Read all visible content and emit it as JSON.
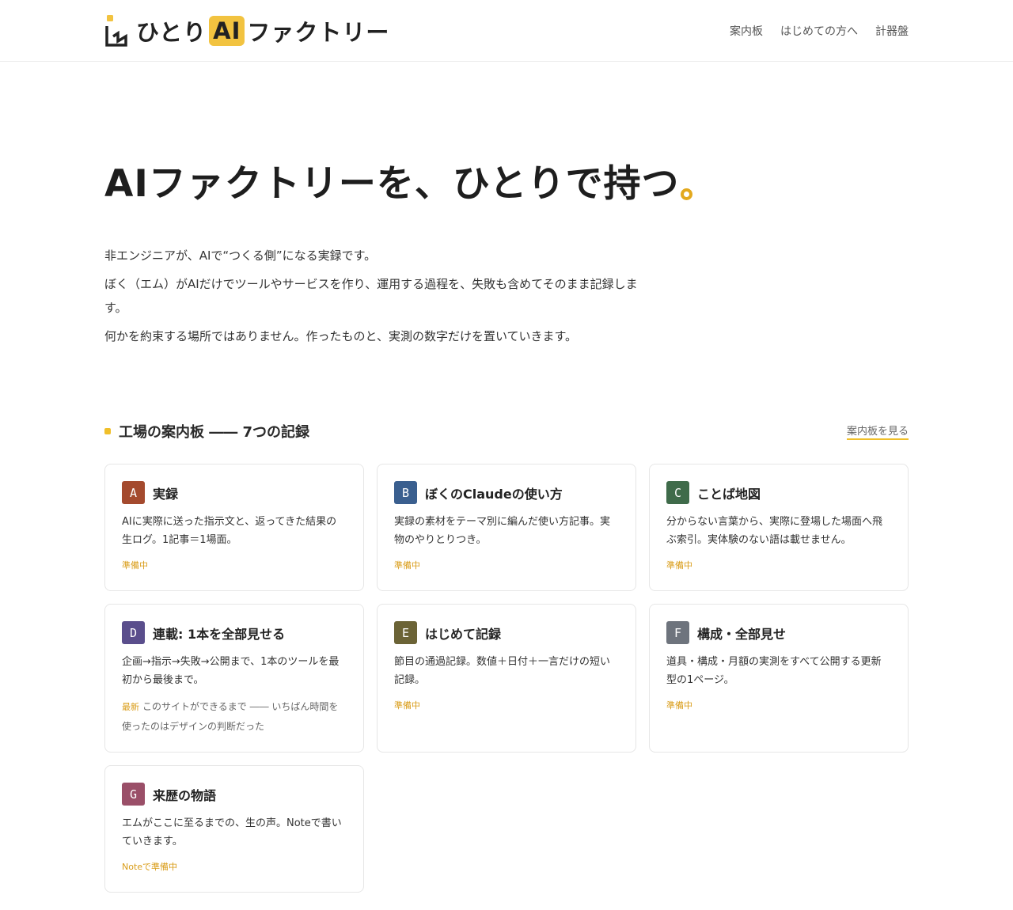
{
  "header": {
    "logo": {
      "word_before": "ひとり",
      "word_ai": "AI",
      "word_after": "ファクトリー"
    },
    "nav": [
      {
        "label": "案内板"
      },
      {
        "label": "はじめての方へ"
      },
      {
        "label": "計器盤"
      }
    ]
  },
  "hero": {
    "title": "AIファクトリーを、ひとりで持つ",
    "lead": [
      "非エンジニアが、AIで“つくる側”になる実録です。",
      "ぼく（エム）がAIだけでツールやサービスを作り、運用する過程を、失敗も含めてそのまま記録します。",
      "何かを約束する場所ではありません。作ったものと、実測の数字だけを置いていきます。"
    ]
  },
  "section": {
    "title": "工場の案内板 ―― 7つの記録",
    "link": "案内板を見る"
  },
  "cards": [
    {
      "letter": "A",
      "color": "#a44a2e",
      "title": "実録",
      "desc": "AIに実際に送った指示文と、返ってきた結果の生ログ。1記事＝1場面。",
      "status": "準備中"
    },
    {
      "letter": "B",
      "color": "#3a5f8f",
      "title": "ぼくのClaudeの使い方",
      "desc": "実録の素材をテーマ別に編んだ使い方記事。実物のやりとりつき。",
      "status": "準備中"
    },
    {
      "letter": "C",
      "color": "#3f6b4a",
      "title": "ことば地図",
      "desc": "分からない言葉から、実際に登場した場面へ飛ぶ索引。実体験のない語は載せません。",
      "status": "準備中"
    },
    {
      "letter": "D",
      "color": "#5a4e8c",
      "title": "連載: 1本を全部見せる",
      "desc": "企画→指示→失敗→公開まで、1本のツールを最初から最後まで。",
      "latest_tag": "最新",
      "latest_text": "このサイトができるまで ―― いちばん時間を使ったのはデザインの判断だった"
    },
    {
      "letter": "E",
      "color": "#6b6336",
      "title": "はじめて記録",
      "desc": "節目の通過記録。数値＋日付＋一言だけの短い記録。",
      "status": "準備中"
    },
    {
      "letter": "F",
      "color": "#6e747d",
      "title": "構成・全部見せ",
      "desc": "道具・構成・月額の実測をすべて公開する更新型の1ページ。",
      "status": "準備中"
    },
    {
      "letter": "G",
      "color": "#9a4f68",
      "title": "来歴の物語",
      "desc": "エムがここに至るまでの、生の声。Noteで書いていきます。",
      "status": "Noteで準備中"
    }
  ],
  "colors": {
    "accent": "#f0bf2a",
    "status": "#d99c18"
  }
}
